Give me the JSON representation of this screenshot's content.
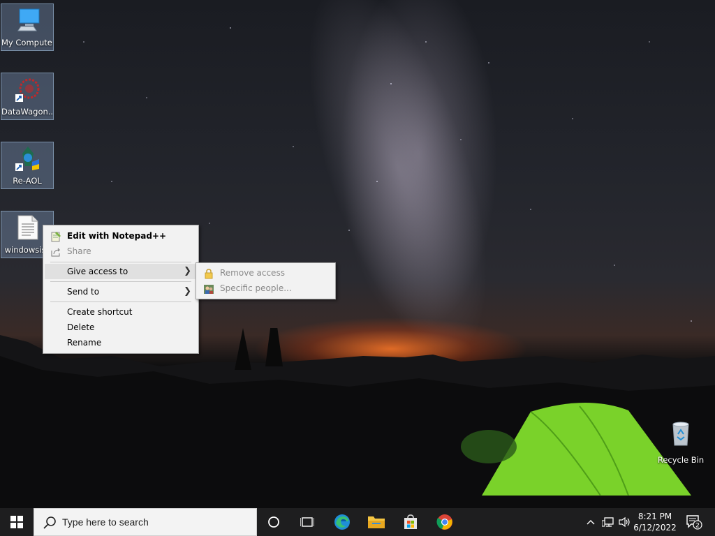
{
  "desktop": {
    "icons": [
      {
        "label": "My Computer"
      },
      {
        "label": "DataWagon..."
      },
      {
        "label": "Re-AOL"
      },
      {
        "label": "windowsiss"
      },
      {
        "label": "Recycle Bin"
      }
    ]
  },
  "context_menu": {
    "items": [
      {
        "label": "Edit with Notepad++"
      },
      {
        "label": "Share"
      },
      {
        "label": "Give access to"
      },
      {
        "label": "Send to"
      },
      {
        "label": "Create shortcut"
      },
      {
        "label": "Delete"
      },
      {
        "label": "Rename"
      }
    ]
  },
  "submenu": {
    "items": [
      {
        "label": "Remove access"
      },
      {
        "label": "Specific people..."
      }
    ]
  },
  "taskbar": {
    "search_placeholder": "Type here to search",
    "clock_time": "8:21 PM",
    "clock_date": "6/12/2022",
    "notification_count": "2"
  },
  "colors": {
    "taskbar_bg": "#1e1e1f",
    "menu_bg": "#f2f2f2",
    "menu_highlight": "#e0e0e0",
    "disabled_text": "#8a8a8a"
  }
}
